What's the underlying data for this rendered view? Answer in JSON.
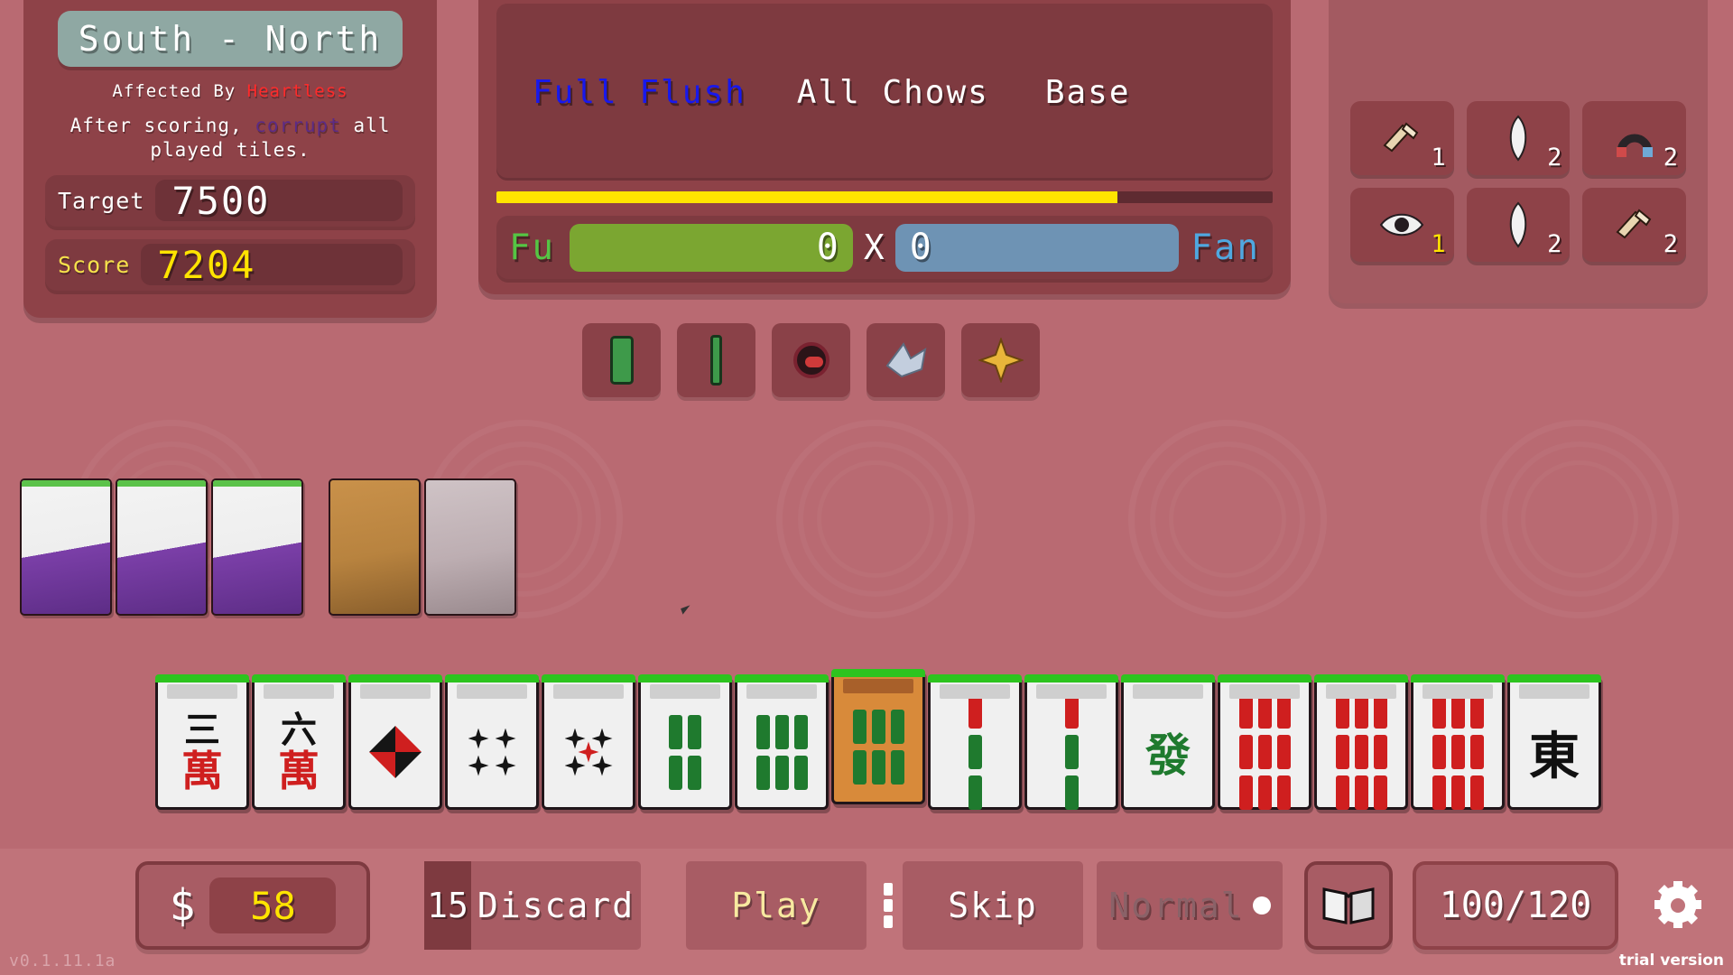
{
  "round": {
    "title": "South - North",
    "affected_prefix": "Affected By ",
    "affected_name": "Heartless",
    "effect_pre": "After scoring, ",
    "effect_kw": "corrupt",
    "effect_post": " all played tiles.",
    "target_label": "Target",
    "target_value": "7500",
    "score_label": "Score",
    "score_value": "7204"
  },
  "scoring": {
    "yaku": [
      {
        "label": "Full Flush",
        "color": "blue"
      },
      {
        "label": "All Chows",
        "color": "white"
      },
      {
        "label": "Base",
        "color": "white"
      }
    ],
    "progress_percent": 80,
    "fu_label": "Fu",
    "fu_value": "0",
    "multiply_symbol": "X",
    "fan_value": "0",
    "fan_label": "Fan"
  },
  "played_tiles": [
    {
      "name": "bamboo-tile"
    },
    {
      "name": "bamboo-stick-tile"
    },
    {
      "name": "red-dragon-tile"
    },
    {
      "name": "bird-tile"
    },
    {
      "name": "gold-star-tile"
    }
  ],
  "items": [
    {
      "name": "scroll-brush-item",
      "count": "1",
      "count_color": "white"
    },
    {
      "name": "feather-item",
      "count": "2",
      "count_color": "white"
    },
    {
      "name": "magnet-item",
      "count": "2",
      "count_color": "white"
    },
    {
      "name": "eye-item",
      "count": "1",
      "count_color": "gold"
    },
    {
      "name": "feather-item",
      "count": "2",
      "count_color": "white"
    },
    {
      "name": "scroll-brush-item",
      "count": "2",
      "count_color": "white"
    }
  ],
  "discarded": [
    {
      "name": "corrupt-tile",
      "style": "purple"
    },
    {
      "name": "corrupt-tile",
      "style": "purple"
    },
    {
      "name": "corrupt-tile",
      "style": "purple"
    },
    {
      "name": "gold-tile",
      "style": "gold"
    },
    {
      "name": "grey-tile",
      "style": "grey"
    }
  ],
  "hand": [
    {
      "name": "3-characters-tile",
      "type": "character",
      "num": "三",
      "suit": "萬",
      "selected": false
    },
    {
      "name": "6-characters-tile",
      "type": "character",
      "num": "六",
      "suit": "萬",
      "selected": false
    },
    {
      "name": "red-dragon-pinwheel-tile",
      "type": "pinwheel",
      "selected": false
    },
    {
      "name": "4-dots-tile",
      "type": "dots",
      "count": 4,
      "red": 0,
      "selected": false
    },
    {
      "name": "5-dots-tile",
      "type": "dots",
      "count": 5,
      "red": 1,
      "selected": false
    },
    {
      "name": "4-bamboo-tile",
      "type": "bamboo",
      "count": 4,
      "red": 0,
      "selected": false
    },
    {
      "name": "6-bamboo-tile",
      "type": "bamboo",
      "count": 6,
      "red": 0,
      "selected": false
    },
    {
      "name": "6-bamboo-tile-selected",
      "type": "bamboo",
      "count": 6,
      "red": 0,
      "selected": true
    },
    {
      "name": "1-bamboo-red-tile",
      "type": "bamboo",
      "count": 1,
      "red": 1,
      "selected": false
    },
    {
      "name": "1-bamboo-red-tile",
      "type": "bamboo",
      "count": 1,
      "red": 1,
      "selected": false
    },
    {
      "name": "green-dragon-tile",
      "type": "dragon",
      "ch": "發",
      "selected": false
    },
    {
      "name": "9-bamboo-tile",
      "type": "bamboo",
      "count": 9,
      "red": 9,
      "selected": false
    },
    {
      "name": "9-bamboo-tile",
      "type": "bamboo",
      "count": 9,
      "red": 9,
      "selected": false
    },
    {
      "name": "9-bamboo-tile",
      "type": "bamboo",
      "count": 9,
      "red": 9,
      "selected": false
    },
    {
      "name": "east-wind-tile",
      "type": "wind",
      "ch": "東",
      "selected": false
    }
  ],
  "toolbar": {
    "money_symbol": "$",
    "money_value": "58",
    "discard_count": "15",
    "discard_label": "Discard",
    "play_label": "Play",
    "skip_label": "Skip",
    "mode_label": "Normal",
    "book_icon": "book-icon",
    "deck_value": "100/120",
    "gear_icon": "gear-icon"
  },
  "footer": {
    "version": "v0.1.11.1a",
    "trial": "trial version"
  },
  "colors": {
    "background": "#c0737a",
    "panel": "#8e4248",
    "banner": "#8fa8a3",
    "accent_yellow": "#ffe400",
    "fu_green": "#7ba631",
    "fan_blue": "#6e93b4",
    "yaku_blue": "#1818ec",
    "bad_red": "#ff2a2a",
    "corrupt_purple": "#5b2b86"
  }
}
